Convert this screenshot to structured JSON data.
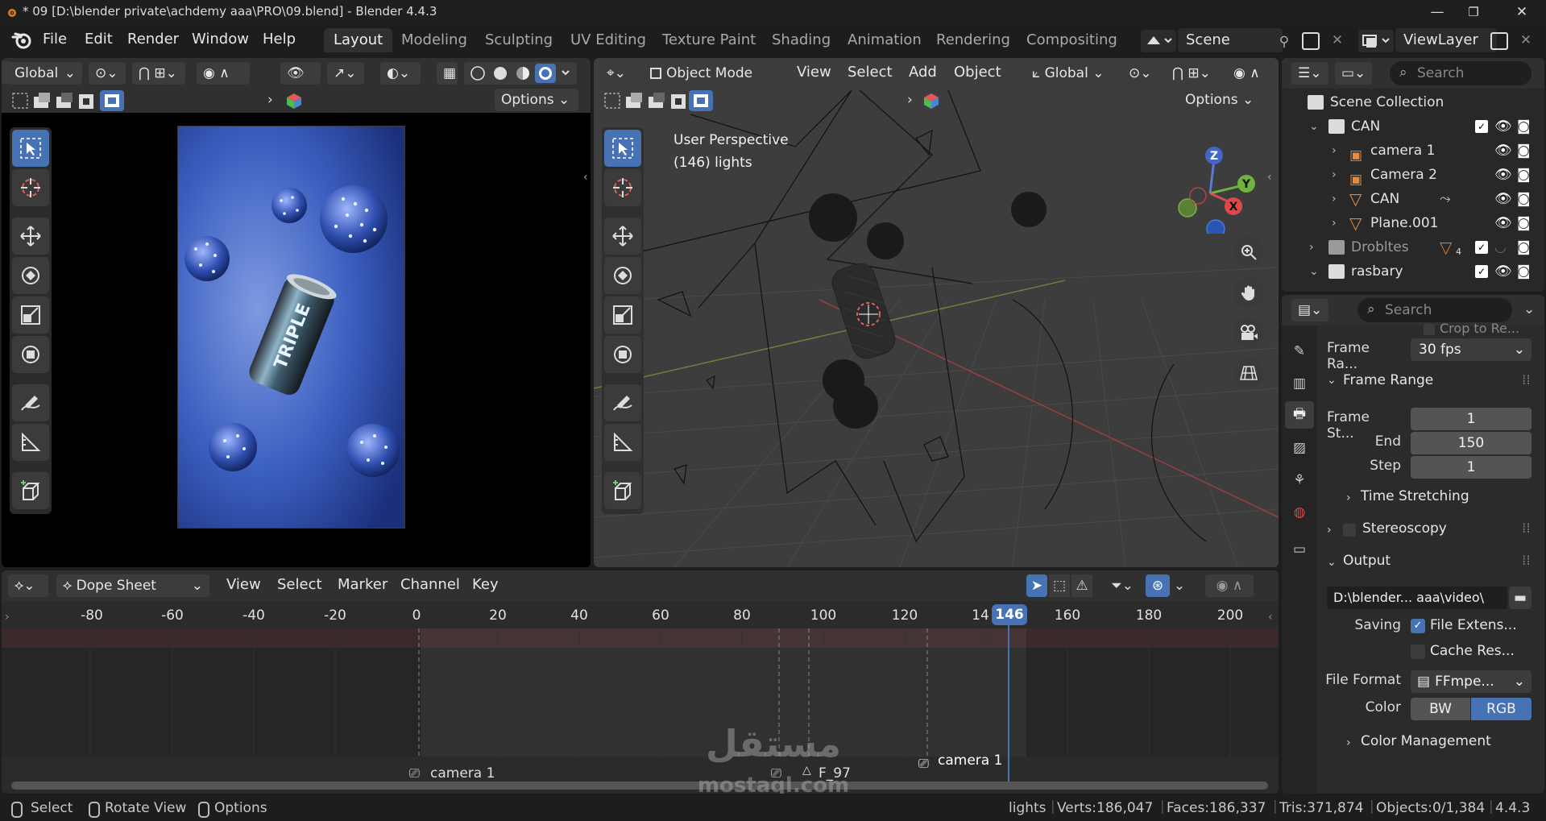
{
  "window": {
    "title": "* 09 [D:\\blender private\\achdemy aaa\\PRO\\09.blend] - Blender 4.4.3",
    "minimize": "—",
    "maximize": "❐",
    "close": "✕"
  },
  "menu": {
    "items": [
      "File",
      "Edit",
      "Render",
      "Window",
      "Help"
    ],
    "workspaces": [
      "Layout",
      "Modeling",
      "Sculpting",
      "UV Editing",
      "Texture Paint",
      "Shading",
      "Animation",
      "Rendering",
      "Compositing"
    ],
    "active_workspace": "Layout",
    "scene": "Scene",
    "view_layer": "ViewLayer"
  },
  "image_editor": {
    "orientation": "Global",
    "options": "Options"
  },
  "viewport": {
    "mode": "Object Mode",
    "menus": [
      "View",
      "Select",
      "Add",
      "Object"
    ],
    "orientation": "Global",
    "options": "Options",
    "overlay_line1": "User Perspective",
    "overlay_line2": "(146) lights",
    "gizmo": {
      "z": "Z",
      "y": "Y",
      "x": "X"
    }
  },
  "outliner": {
    "search_placeholder": "Search",
    "rows": [
      {
        "label": "Scene Collection"
      },
      {
        "label": "CAN"
      },
      {
        "label": "camera 1"
      },
      {
        "label": "Camera 2"
      },
      {
        "label": "CAN"
      },
      {
        "label": "Plane.001"
      },
      {
        "label": "Drobltes"
      },
      {
        "label": "rasbary"
      }
    ],
    "drobltes_count": "4"
  },
  "properties": {
    "search_placeholder": "Search",
    "crop_label": "Crop to Re...",
    "frame_rate_label": "Frame Ra...",
    "frame_rate_value": "30 fps",
    "frame_range_title": "Frame Range",
    "frame_start_label": "Frame St...",
    "frame_start": "1",
    "end_label": "End",
    "end_value": "150",
    "step_label": "Step",
    "step_value": "1",
    "time_stretching": "Time Stretching",
    "stereoscopy": "Stereoscopy",
    "output_title": "Output",
    "output_path": "D:\\blender... aaa\\video\\",
    "saving_label": "Saving",
    "file_ext": "File Extens...",
    "cache_res": "Cache Res...",
    "file_format_label": "File Format",
    "file_format_value": "FFmpe...",
    "color_label": "Color",
    "color_bw": "BW",
    "color_rgb": "RGB",
    "color_management": "Color Management"
  },
  "dopesheet": {
    "mode": "Dope Sheet",
    "menus": [
      "View",
      "Select",
      "Marker",
      "Channel",
      "Key"
    ],
    "ticks": [
      "-80",
      "-60",
      "-40",
      "-20",
      "0",
      "20",
      "40",
      "60",
      "80",
      "100",
      "120",
      "14",
      "160",
      "180",
      "200"
    ],
    "current_frame": "146",
    "markers": [
      {
        "label": "camera 1",
        "frame": 0
      },
      {
        "label": "F_97",
        "frame": 97
      },
      {
        "label": "camera 1",
        "frame": 126
      }
    ]
  },
  "statusbar": {
    "select": "Select",
    "rotate": "Rotate View",
    "options": "Options",
    "collection": "lights",
    "verts": "Verts:186,047",
    "faces": "Faces:186,337",
    "tris": "Tris:371,874",
    "objects": "Objects:0/1,384",
    "version": "4.4.3"
  },
  "watermark": {
    "arabic": "مستقل",
    "latin": "mostaql.com"
  }
}
